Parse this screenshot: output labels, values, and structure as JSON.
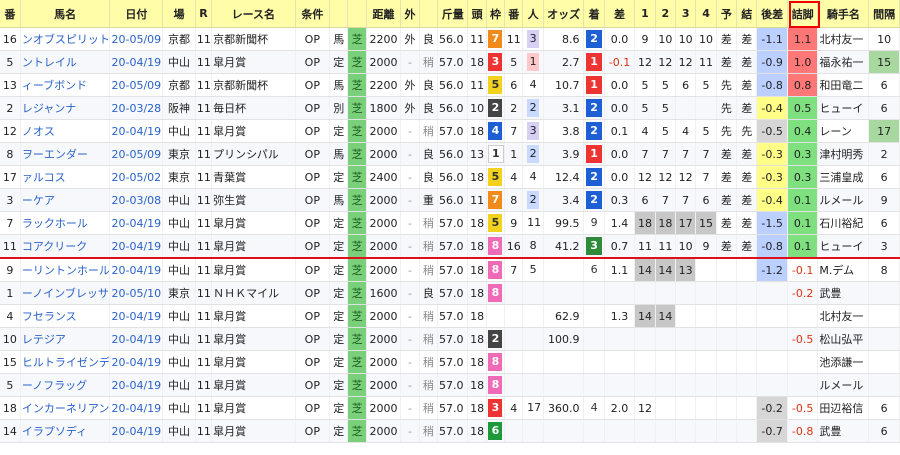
{
  "headers": [
    "番",
    "馬名",
    "日付",
    "場",
    "R",
    "レース名",
    "条件",
    "",
    "",
    "距離",
    "外",
    "",
    "斤量",
    "頭",
    "枠",
    "番",
    "人",
    "オッズ",
    "着",
    "差",
    "1",
    "2",
    "3",
    "4",
    "予",
    "結",
    "後差",
    "詰脚",
    "騎手名",
    "間隔"
  ],
  "highlighted_header": "詰脚",
  "accent_color": "#e00000",
  "rows": [
    {
      "no": "16",
      "name": "ンオブスピリット",
      "date": "20-05/09",
      "place": "京都",
      "r": "11",
      "race": "京都新聞杯",
      "cond": "OP",
      "sex": "馬",
      "surf": "芝",
      "dist": "2200",
      "out": "外",
      "track": "良",
      "kin": "56.0",
      "heads": "11",
      "waku": "7",
      "uma": "11",
      "ninki": "3",
      "odds": "8.6",
      "chaku": "2",
      "diff": "0.0",
      "c1": "9",
      "c2": "10",
      "c3": "10",
      "c4": "10",
      "yo": "差",
      "ketsu": "差",
      "atosa": "-1.1",
      "tsume": "1.1",
      "jockey": "北村友一",
      "kankaku": "10"
    },
    {
      "no": "5",
      "name": "ントレイル",
      "date": "20-04/19",
      "place": "中山",
      "r": "11",
      "race": "皐月賞",
      "cond": "OP",
      "sex": "定",
      "surf": "芝",
      "dist": "2000",
      "out": "-",
      "track": "稍",
      "kin": "57.0",
      "heads": "18",
      "waku": "3",
      "uma": "5",
      "ninki": "1",
      "odds": "2.7",
      "chaku": "1",
      "diff": "-0.1",
      "c1": "12",
      "c2": "12",
      "c3": "12",
      "c4": "11",
      "yo": "差",
      "ketsu": "差",
      "atosa": "-0.9",
      "tsume": "1.0",
      "jockey": "福永祐一",
      "kankaku": "15"
    },
    {
      "no": "13",
      "name": "ィーブボンド",
      "date": "20-05/09",
      "place": "京都",
      "r": "11",
      "race": "京都新聞杯",
      "cond": "OP",
      "sex": "馬",
      "surf": "芝",
      "dist": "2200",
      "out": "外",
      "track": "良",
      "kin": "56.0",
      "heads": "11",
      "waku": "5",
      "uma": "6",
      "ninki": "4",
      "odds": "10.7",
      "chaku": "1",
      "diff": "0.0",
      "c1": "5",
      "c2": "5",
      "c3": "6",
      "c4": "5",
      "yo": "先",
      "ketsu": "差",
      "atosa": "-0.8",
      "tsume": "0.8",
      "jockey": "和田竜二",
      "kankaku": "6"
    },
    {
      "no": "2",
      "name": "レジャンナ",
      "date": "20-03/28",
      "place": "阪神",
      "r": "11",
      "race": "毎日杯",
      "cond": "OP",
      "sex": "別",
      "surf": "芝",
      "dist": "1800",
      "out": "外",
      "track": "良",
      "kin": "56.0",
      "heads": "10",
      "waku": "2",
      "uma": "2",
      "ninki": "2",
      "odds": "3.1",
      "chaku": "2",
      "diff": "0.0",
      "c1": "5",
      "c2": "5",
      "c3": "",
      "c4": "",
      "yo": "先",
      "ketsu": "差",
      "atosa": "-0.4",
      "tsume": "0.5",
      "jockey": "ヒューイ",
      "kankaku": "6"
    },
    {
      "no": "12",
      "name": "ノオス",
      "date": "20-04/19",
      "place": "中山",
      "r": "11",
      "race": "皐月賞",
      "cond": "OP",
      "sex": "定",
      "surf": "芝",
      "dist": "2000",
      "out": "-",
      "track": "稍",
      "kin": "57.0",
      "heads": "18",
      "waku": "4",
      "uma": "7",
      "ninki": "3",
      "odds": "3.8",
      "chaku": "2",
      "diff": "0.1",
      "c1": "4",
      "c2": "5",
      "c3": "4",
      "c4": "5",
      "yo": "先",
      "ketsu": "先",
      "atosa": "-0.5",
      "tsume": "0.4",
      "jockey": "レーン",
      "kankaku": "17"
    },
    {
      "no": "8",
      "name": "ヲーエンダー",
      "date": "20-05/09",
      "place": "東京",
      "r": "11",
      "race": "プリンシパル",
      "cond": "OP",
      "sex": "馬",
      "surf": "芝",
      "dist": "2000",
      "out": "-",
      "track": "良",
      "kin": "56.0",
      "heads": "13",
      "waku": "1",
      "uma": "1",
      "ninki": "2",
      "odds": "3.9",
      "chaku": "1",
      "diff": "0.0",
      "c1": "7",
      "c2": "7",
      "c3": "7",
      "c4": "7",
      "yo": "差",
      "ketsu": "差",
      "atosa": "-0.3",
      "tsume": "0.3",
      "jockey": "津村明秀",
      "kankaku": "2"
    },
    {
      "no": "17",
      "name": "ァルコス",
      "date": "20-05/02",
      "place": "東京",
      "r": "11",
      "race": "青葉賞",
      "cond": "OP",
      "sex": "定",
      "surf": "芝",
      "dist": "2400",
      "out": "-",
      "track": "良",
      "kin": "56.0",
      "heads": "18",
      "waku": "5",
      "uma": "4",
      "ninki": "4",
      "odds": "12.4",
      "chaku": "2",
      "diff": "0.0",
      "c1": "12",
      "c2": "12",
      "c3": "12",
      "c4": "7",
      "yo": "差",
      "ketsu": "差",
      "atosa": "-0.3",
      "tsume": "0.3",
      "jockey": "三浦皇成",
      "kankaku": "6"
    },
    {
      "no": "3",
      "name": "ーケア",
      "date": "20-03/08",
      "place": "中山",
      "r": "11",
      "race": "弥生賞",
      "cond": "OP",
      "sex": "馬",
      "surf": "芝",
      "dist": "2000",
      "out": "-",
      "track": "重",
      "kin": "56.0",
      "heads": "11",
      "waku": "7",
      "uma": "8",
      "ninki": "2",
      "odds": "3.4",
      "chaku": "2",
      "diff": "0.3",
      "c1": "6",
      "c2": "7",
      "c3": "7",
      "c4": "6",
      "yo": "差",
      "ketsu": "差",
      "atosa": "-0.4",
      "tsume": "0.1",
      "jockey": "ルメール",
      "kankaku": "9"
    },
    {
      "no": "7",
      "name": "ラックホール",
      "date": "20-04/19",
      "place": "中山",
      "r": "11",
      "race": "皐月賞",
      "cond": "OP",
      "sex": "定",
      "surf": "芝",
      "dist": "2000",
      "out": "-",
      "track": "稍",
      "kin": "57.0",
      "heads": "18",
      "waku": "5",
      "uma": "9",
      "ninki": "11",
      "odds": "99.5",
      "chaku": "9",
      "diff": "1.4",
      "c1": "18",
      "c2": "18",
      "c3": "17",
      "c4": "15",
      "yo": "差",
      "ketsu": "差",
      "atosa": "-1.5",
      "tsume": "0.1",
      "jockey": "石川裕紀",
      "kankaku": "6"
    },
    {
      "no": "11",
      "name": "コアクリーク",
      "date": "20-04/19",
      "place": "中山",
      "r": "11",
      "race": "皐月賞",
      "cond": "OP",
      "sex": "定",
      "surf": "芝",
      "dist": "2000",
      "out": "-",
      "track": "稍",
      "kin": "57.0",
      "heads": "18",
      "waku": "8",
      "uma": "16",
      "ninki": "8",
      "odds": "41.2",
      "chaku": "3",
      "diff": "0.7",
      "c1": "11",
      "c2": "11",
      "c3": "10",
      "c4": "9",
      "yo": "差",
      "ketsu": "差",
      "atosa": "-0.8",
      "tsume": "0.1",
      "jockey": "ヒューイ",
      "kankaku": "3"
    },
    {
      "no": "9",
      "name": "ーリントンホール",
      "date": "20-04/19",
      "place": "中山",
      "r": "11",
      "race": "皐月賞",
      "cond": "OP",
      "sex": "定",
      "surf": "芝",
      "dist": "2000",
      "out": "-",
      "track": "稍",
      "kin": "57.0",
      "heads": "18",
      "waku": "8",
      "uma": "7",
      "ninki": "5",
      "odds": "",
      "chaku": "6",
      "diff": "1.1",
      "c1": "14",
      "c2": "14",
      "c3": "13",
      "c4": "",
      "yo": "",
      "ketsu": "",
      "atosa": "-1.2",
      "tsume": "-0.1",
      "jockey": "M.デム",
      "kankaku": "8"
    },
    {
      "no": "1",
      "name": "ーノインブレッサ",
      "date": "20-05/10",
      "place": "東京",
      "r": "11",
      "race": "ＮＨＫマイル",
      "cond": "OP",
      "sex": "定",
      "surf": "芝",
      "dist": "1600",
      "out": "-",
      "track": "良",
      "kin": "57.0",
      "heads": "18",
      "waku": "8",
      "uma": "",
      "ninki": "",
      "odds": "",
      "chaku": "",
      "diff": "",
      "c1": "",
      "c2": "",
      "c3": "",
      "c4": "",
      "yo": "",
      "ketsu": "",
      "atosa": "",
      "tsume": "-0.2",
      "jockey": "武豊",
      "kankaku": ""
    },
    {
      "no": "4",
      "name": "フセランス",
      "date": "20-04/19",
      "place": "中山",
      "r": "11",
      "race": "皐月賞",
      "cond": "OP",
      "sex": "定",
      "surf": "芝",
      "dist": "2000",
      "out": "-",
      "track": "稍",
      "kin": "57.0",
      "heads": "18",
      "waku": "",
      "uma": "",
      "ninki": "",
      "odds": "62.9",
      "chaku": "",
      "diff": "1.3",
      "c1": "14",
      "c2": "14",
      "c3": "",
      "c4": "",
      "yo": "",
      "ketsu": "",
      "atosa": "",
      "tsume": "",
      "jockey": "北村友一",
      "kankaku": ""
    },
    {
      "no": "10",
      "name": "レテジア",
      "date": "20-04/19",
      "place": "中山",
      "r": "11",
      "race": "皐月賞",
      "cond": "OP",
      "sex": "定",
      "surf": "芝",
      "dist": "2000",
      "out": "-",
      "track": "稍",
      "kin": "57.0",
      "heads": "18",
      "waku": "2",
      "uma": "",
      "ninki": "",
      "odds": "100.9",
      "chaku": "",
      "diff": "",
      "c1": "",
      "c2": "",
      "c3": "",
      "c4": "",
      "yo": "",
      "ketsu": "",
      "atosa": "",
      "tsume": "-0.5",
      "jockey": "松山弘平",
      "kankaku": ""
    },
    {
      "no": "15",
      "name": "ヒルトライゼンデ",
      "date": "20-04/19",
      "place": "中山",
      "r": "11",
      "race": "皐月賞",
      "cond": "OP",
      "sex": "定",
      "surf": "芝",
      "dist": "2000",
      "out": "-",
      "track": "稍",
      "kin": "57.0",
      "heads": "18",
      "waku": "8",
      "uma": "",
      "ninki": "",
      "odds": "",
      "chaku": "",
      "diff": "",
      "c1": "",
      "c2": "",
      "c3": "",
      "c4": "",
      "yo": "",
      "ketsu": "",
      "atosa": "",
      "tsume": "",
      "jockey": "池添謙一",
      "kankaku": ""
    },
    {
      "no": "5",
      "name": "ーノフラッグ",
      "date": "20-04/19",
      "place": "中山",
      "r": "11",
      "race": "皐月賞",
      "cond": "OP",
      "sex": "定",
      "surf": "芝",
      "dist": "2000",
      "out": "-",
      "track": "稍",
      "kin": "57.0",
      "heads": "18",
      "waku": "8",
      "uma": "",
      "ninki": "",
      "odds": "",
      "chaku": "",
      "diff": "",
      "c1": "",
      "c2": "",
      "c3": "",
      "c4": "",
      "yo": "",
      "ketsu": "",
      "atosa": "",
      "tsume": "",
      "jockey": "ルメール",
      "kankaku": ""
    },
    {
      "no": "18",
      "name": "インカーネリアン",
      "date": "20-04/19",
      "place": "中山",
      "r": "11",
      "race": "皐月賞",
      "cond": "OP",
      "sex": "定",
      "surf": "芝",
      "dist": "2000",
      "out": "-",
      "track": "稍",
      "kin": "57.0",
      "heads": "18",
      "waku": "3",
      "uma": "4",
      "ninki": "17",
      "odds": "360.0",
      "chaku": "4",
      "diff": "2.0",
      "c1": "12",
      "c2": "",
      "c3": "",
      "c4": "",
      "yo": "",
      "ketsu": "",
      "atosa": "-0.2",
      "tsume": "-0.5",
      "jockey": "田辺裕信",
      "kankaku": "6"
    },
    {
      "no": "14",
      "name": "イラプソディ",
      "date": "20-04/19",
      "place": "中山",
      "r": "11",
      "race": "皐月賞",
      "cond": "OP",
      "sex": "定",
      "surf": "芝",
      "dist": "2000",
      "out": "-",
      "track": "稍",
      "kin": "57.0",
      "heads": "18",
      "waku": "6",
      "uma": "",
      "ninki": "",
      "odds": "",
      "chaku": "",
      "diff": "",
      "c1": "",
      "c2": "",
      "c3": "",
      "c4": "",
      "yo": "",
      "ketsu": "",
      "atosa": "-0.7",
      "tsume": "-0.8",
      "jockey": "武豊",
      "kankaku": "6"
    }
  ]
}
